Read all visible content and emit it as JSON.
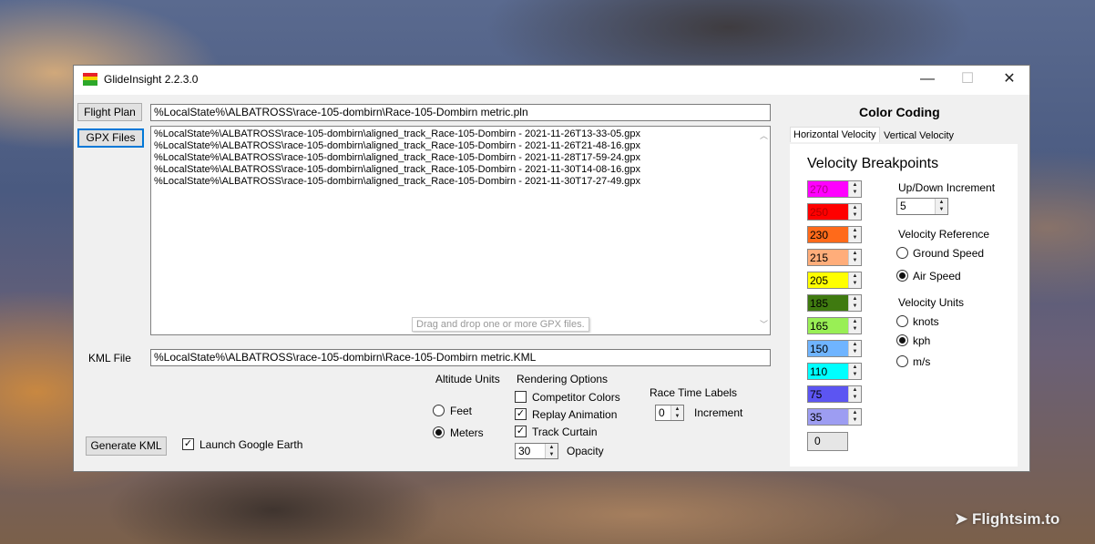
{
  "window": {
    "title": "GlideInsight 2.2.3.0",
    "controls": {
      "minimize": "—",
      "maximize": "☐",
      "close": "✕"
    }
  },
  "files": {
    "flight_plan_button": "Flight Plan",
    "flight_plan_path": "%LocalState%\\ALBATROSS\\race-105-dombirn\\Race-105-Dombirn metric.pln",
    "gpx_button": "GPX Files",
    "gpx_list": [
      "%LocalState%\\ALBATROSS\\race-105-dombirn\\aligned_track_Race-105-Dombirn - 2021-11-26T13-33-05.gpx",
      "%LocalState%\\ALBATROSS\\race-105-dombirn\\aligned_track_Race-105-Dombirn - 2021-11-26T21-48-16.gpx",
      "%LocalState%\\ALBATROSS\\race-105-dombirn\\aligned_track_Race-105-Dombirn - 2021-11-28T17-59-24.gpx",
      "%LocalState%\\ALBATROSS\\race-105-dombirn\\aligned_track_Race-105-Dombirn - 2021-11-30T14-08-16.gpx",
      "%LocalState%\\ALBATROSS\\race-105-dombirn\\aligned_track_Race-105-Dombirn - 2021-11-30T17-27-49.gpx"
    ],
    "gpx_hint": "Drag and drop one or more GPX files.",
    "kml_label": "KML File",
    "kml_path": "%LocalState%\\ALBATROSS\\race-105-dombirn\\Race-105-Dombirn metric.KML"
  },
  "options": {
    "altitude_units_label": "Altitude Units",
    "altitude_feet": "Feet",
    "altitude_meters": "Meters",
    "altitude_selected": "Meters",
    "rendering_label": "Rendering Options",
    "competitor_colors": {
      "label": "Competitor Colors",
      "checked": false
    },
    "replay_animation": {
      "label": "Replay Animation",
      "checked": true
    },
    "track_curtain": {
      "label": "Track Curtain",
      "checked": true
    },
    "opacity_value": "30",
    "opacity_label": "Opacity",
    "race_time_label": "Race Time Labels",
    "increment_value": "0",
    "increment_label": "Increment",
    "generate_button": "Generate KML",
    "launch_google_earth": {
      "label": "Launch Google Earth",
      "checked": true
    }
  },
  "color_coding": {
    "title": "Color Coding",
    "tabs": [
      "Horizontal Velocity",
      "Vertical Velocity"
    ],
    "active_tab": "Horizontal Velocity",
    "breakpoints_title": "Velocity Breakpoints",
    "breakpoints": [
      {
        "value": "270",
        "color": "#ff00ff",
        "text_color": "#b0008a"
      },
      {
        "value": "250",
        "color": "#ff0000",
        "text_color": "#b00000"
      },
      {
        "value": "230",
        "color": "#ff6a1a",
        "text_color": "#000000"
      },
      {
        "value": "215",
        "color": "#ffad7a",
        "text_color": "#000000"
      },
      {
        "value": "205",
        "color": "#ffff00",
        "text_color": "#000000"
      },
      {
        "value": "185",
        "color": "#3f7a10",
        "text_color": "#000000"
      },
      {
        "value": "165",
        "color": "#99ef55",
        "text_color": "#000000"
      },
      {
        "value": "150",
        "color": "#6fb4ff",
        "text_color": "#000000"
      },
      {
        "value": "110",
        "color": "#00ffff",
        "text_color": "#000000"
      },
      {
        "value": "75",
        "color": "#5c55f2",
        "text_color": "#000000"
      },
      {
        "value": "35",
        "color": "#9d9df2",
        "text_color": "#000000"
      }
    ],
    "zero_value": "0",
    "updown_label": "Up/Down Increment",
    "updown_value": "5",
    "velocity_reference_label": "Velocity Reference",
    "ground_speed": "Ground Speed",
    "air_speed": "Air Speed",
    "reference_selected": "Air Speed",
    "velocity_units_label": "Velocity Units",
    "knots": "knots",
    "kph": "kph",
    "ms": "m/s",
    "units_selected": "kph"
  },
  "watermark": "Flightsim.to"
}
